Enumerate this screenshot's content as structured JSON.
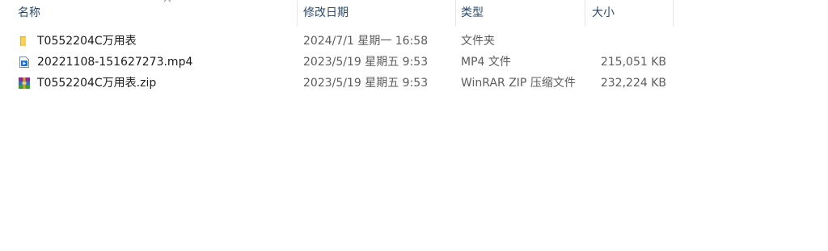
{
  "columns": {
    "name": "名称",
    "modified": "修改日期",
    "type": "类型",
    "size": "大小"
  },
  "files": [
    {
      "name": "T0552204C万用表",
      "modified": "2024/7/1 星期一 16:58",
      "type": "文件夹",
      "size": "",
      "icon": "folder-icon"
    },
    {
      "name": "20221108-151627273.mp4",
      "modified": "2023/5/19 星期五 9:53",
      "type": "MP4 文件",
      "size": "215,051 KB",
      "icon": "video-file-icon"
    },
    {
      "name": "T0552204C万用表.zip",
      "modified": "2023/5/19 星期五 9:53",
      "type": "WinRAR ZIP 压缩文件",
      "size": "232,224 KB",
      "icon": "winrar-archive-icon"
    }
  ],
  "colors": {
    "header_text": "#2b4a6b",
    "folder": "#f0c24a",
    "video": "#1e73d8"
  }
}
